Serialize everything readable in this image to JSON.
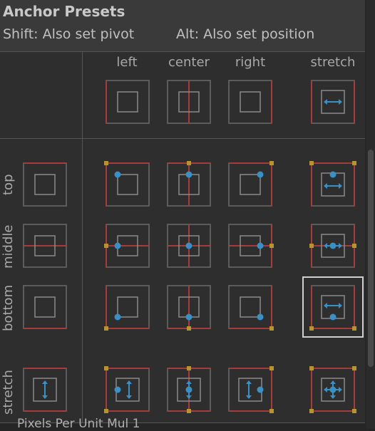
{
  "title": "Anchor Presets",
  "hint_shift": "Shift: Also set pivot",
  "hint_alt": "Alt: Also set position",
  "columns": [
    "left",
    "center",
    "right",
    "stretch"
  ],
  "rows": [
    "top",
    "middle",
    "bottom",
    "stretch"
  ],
  "footer_text": "Pixels Per Unit Mul 1",
  "selected": {
    "row": "bottom",
    "column": "stretch"
  },
  "colors": {
    "anchor_red": "#a63c3c",
    "anchor_point": "#b89332",
    "pivot_blue": "#3a8fc4",
    "frame": "#6a6a6a",
    "selected_border": "#cfcfcf"
  }
}
